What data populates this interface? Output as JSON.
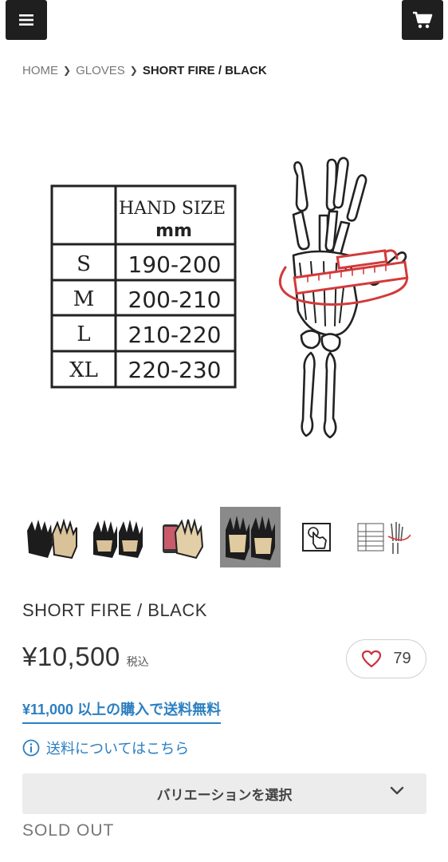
{
  "header": {
    "menu_icon": "hamburger-menu-icon",
    "cart_icon": "shopping-cart-icon"
  },
  "breadcrumb": {
    "items": [
      "HOME",
      "GLOVES"
    ],
    "current": "SHORT FIRE / BLACK"
  },
  "size_chart": {
    "header_line1": "HAND SIZE",
    "header_line2": "mm",
    "rows": [
      {
        "size": "S",
        "range": "190-200"
      },
      {
        "size": "M",
        "range": "200-210"
      },
      {
        "size": "L",
        "range": "210-220"
      },
      {
        "size": "XL",
        "range": "220-230"
      }
    ]
  },
  "product": {
    "title": "SHORT FIRE / BLACK",
    "price": "¥10,500",
    "tax_label": "税込",
    "favorite_count": "79"
  },
  "shipping": {
    "free_shipping": "¥11,000 以上の購入で送料無料",
    "info_link": "送料についてはこちら"
  },
  "variation": {
    "label": "バリエーションを選択"
  },
  "status": {
    "sold_out": "SOLD OUT"
  },
  "colors": {
    "accent": "#2c7fc0",
    "header_button": "#1f1f1f",
    "heart": "#c8323c"
  }
}
